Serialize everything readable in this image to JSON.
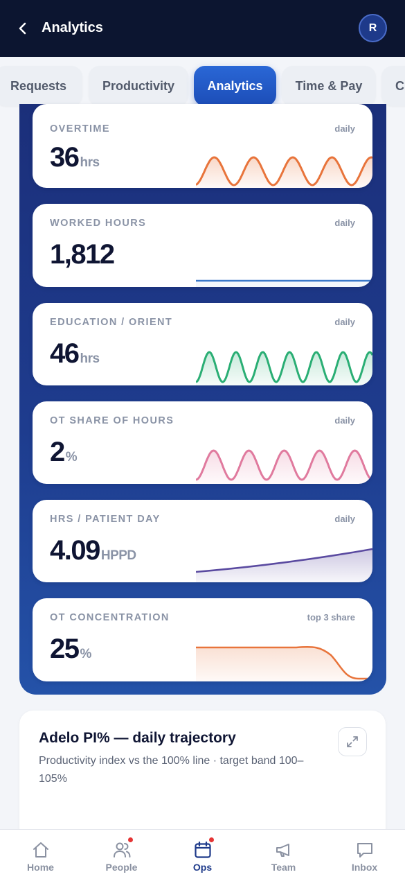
{
  "header": {
    "title": "Analytics",
    "avatar_initial": "R"
  },
  "tabs": [
    {
      "label": "Requests",
      "active": false
    },
    {
      "label": "Productivity",
      "active": false
    },
    {
      "label": "Analytics",
      "active": true
    },
    {
      "label": "Time & Pay",
      "active": false
    },
    {
      "label": "C",
      "active": false
    }
  ],
  "metrics": [
    {
      "label": "OVERTIME",
      "tag": "daily",
      "value": "36",
      "unit": "hrs",
      "spark_color": "#e8743b"
    },
    {
      "label": "WORKED HOURS",
      "tag": "daily",
      "value": "1,812",
      "unit": "",
      "spark_color": "#3a78c9"
    },
    {
      "label": "EDUCATION / ORIENT",
      "tag": "daily",
      "value": "46",
      "unit": "hrs",
      "spark_color": "#2aae74"
    },
    {
      "label": "OT SHARE OF HOURS",
      "tag": "daily",
      "value": "2",
      "unit": "%",
      "spark_color": "#e07a9e"
    },
    {
      "label": "HRS / PATIENT DAY",
      "tag": "daily",
      "value": "4.09",
      "unit": "HPPD",
      "spark_color": "#5a4aa0"
    },
    {
      "label": "OT CONCENTRATION",
      "tag": "top 3 share",
      "value": "25",
      "unit": "%",
      "spark_color": "#e8743b"
    }
  ],
  "trajectory": {
    "title": "Adelo PI% — daily trajectory",
    "subtitle": "Productivity index vs the 100% line · target band 100–105%"
  },
  "bottom_nav": [
    {
      "label": "Home",
      "icon": "home-icon",
      "active": false,
      "badge": false
    },
    {
      "label": "People",
      "icon": "people-icon",
      "active": false,
      "badge": true
    },
    {
      "label": "Ops",
      "icon": "calendar-icon",
      "active": true,
      "badge": true
    },
    {
      "label": "Team",
      "icon": "megaphone-icon",
      "active": false,
      "badge": false
    },
    {
      "label": "Inbox",
      "icon": "inbox-icon",
      "active": false,
      "badge": false
    }
  ],
  "colors": {
    "header_bg": "#0c1530",
    "accent": "#1e4db7",
    "panel": "#1e3c8e",
    "badge": "#e53535"
  }
}
